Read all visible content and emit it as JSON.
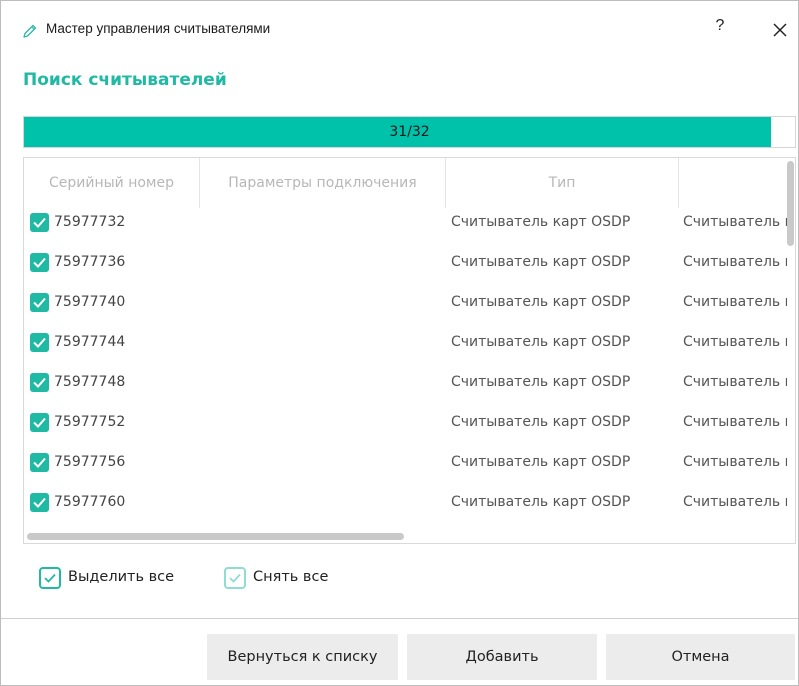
{
  "window": {
    "title": "Мастер управления считывателями",
    "help_label": "?",
    "icon": "pencil-icon"
  },
  "heading": "Поиск считывателей",
  "progress": {
    "text": "31/32",
    "fraction": 0.96875,
    "color": "#00c2aa"
  },
  "table": {
    "columns": [
      "Серийный номер",
      "Параметры подключения",
      "Тип",
      ""
    ],
    "rows": [
      {
        "checked": true,
        "serial": "75977732",
        "params": "",
        "type": "Считыватель карт OSDP",
        "extra": "Считыватель карт OSDP"
      },
      {
        "checked": true,
        "serial": "75977736",
        "params": "",
        "type": "Считыватель карт OSDP",
        "extra": "Считыватель карт OSDP"
      },
      {
        "checked": true,
        "serial": "75977740",
        "params": "",
        "type": "Считыватель карт OSDP",
        "extra": "Считыватель карт OSDP"
      },
      {
        "checked": true,
        "serial": "75977744",
        "params": "",
        "type": "Считыватель карт OSDP",
        "extra": "Считыватель карт OSDP"
      },
      {
        "checked": true,
        "serial": "75977748",
        "params": "",
        "type": "Считыватель карт OSDP",
        "extra": "Считыватель карт OSDP"
      },
      {
        "checked": true,
        "serial": "75977752",
        "params": "",
        "type": "Считыватель карт OSDP",
        "extra": "Считыватель карт OSDP"
      },
      {
        "checked": true,
        "serial": "75977756",
        "params": "",
        "type": "Считыватель карт OSDP",
        "extra": "Считыватель карт OSDP"
      },
      {
        "checked": true,
        "serial": "75977760",
        "params": "",
        "type": "Считыватель карт OSDP",
        "extra": "Считыватель карт OSDP"
      }
    ]
  },
  "selection": {
    "select_all_label": "Выделить все",
    "deselect_all_label": "Снять все"
  },
  "buttons": {
    "back_label": "Вернуться к списку",
    "add_label": "Добавить",
    "cancel_label": "Отмена"
  },
  "colors": {
    "accent": "#1fb9a4",
    "button_bg": "#ececec"
  }
}
